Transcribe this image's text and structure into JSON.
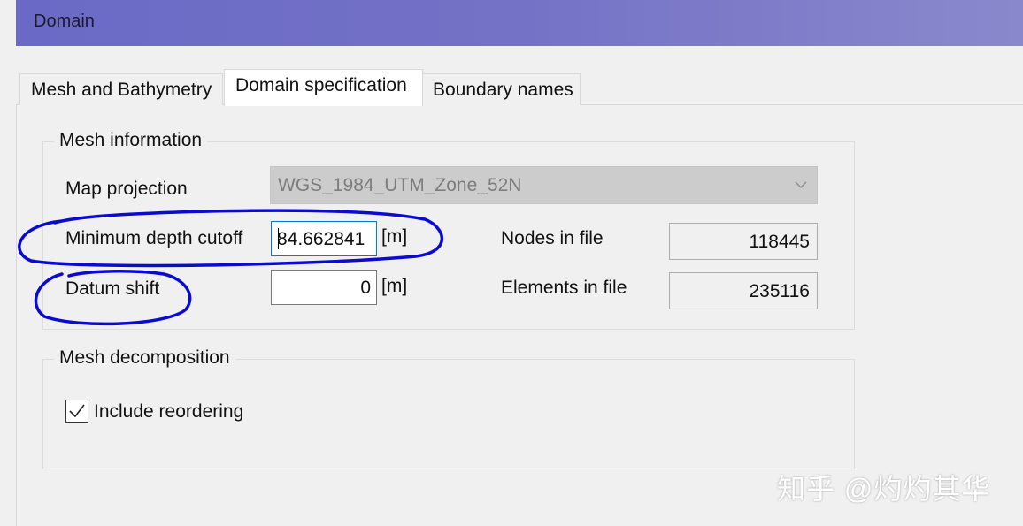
{
  "window": {
    "title": "Domain"
  },
  "tabs": [
    {
      "label": "Mesh and Bathymetry",
      "active": false
    },
    {
      "label": "Domain specification",
      "active": true
    },
    {
      "label": "Boundary names",
      "active": false
    }
  ],
  "mesh_information": {
    "title": "Mesh information",
    "map_projection": {
      "label": "Map projection",
      "value": "WGS_1984_UTM_Zone_52N",
      "enabled": false
    },
    "minimum_depth_cutoff": {
      "label": "Minimum depth cutoff",
      "value": "84.662841",
      "unit": "[m]"
    },
    "datum_shift": {
      "label": "Datum shift",
      "value": "0",
      "unit": "[m]"
    },
    "nodes_in_file": {
      "label": "Nodes in file",
      "value": "118445"
    },
    "elements_in_file": {
      "label": "Elements in file",
      "value": "235116"
    }
  },
  "mesh_decomposition": {
    "title": "Mesh decomposition",
    "include_reordering": {
      "label": "Include reordering",
      "checked": true
    }
  },
  "annotations": {
    "color": "#0a0ad0"
  },
  "watermark": {
    "text": "知乎 @灼灼其华"
  },
  "colors": {
    "titlebar": "#6a6ac6",
    "focus_border": "#0078d7"
  }
}
